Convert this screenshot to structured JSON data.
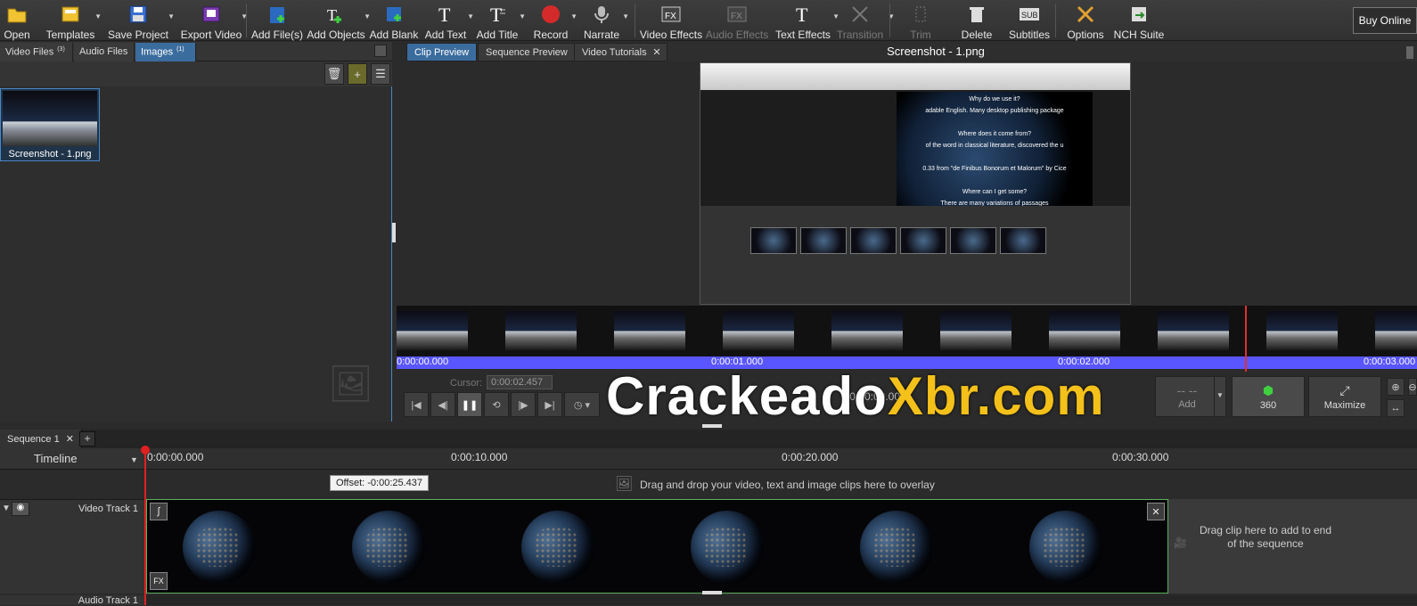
{
  "toolbar": {
    "buttons": [
      {
        "label": "Open",
        "icon": "folder-icon"
      },
      {
        "label": "Templates",
        "icon": "templates-icon"
      },
      {
        "label": "Save Project",
        "icon": "save-icon"
      },
      {
        "label": "Export Video",
        "icon": "export-icon"
      },
      {
        "label": "Add File(s)",
        "icon": "add-file-icon"
      },
      {
        "label": "Add Objects",
        "icon": "add-objects-icon"
      },
      {
        "label": "Add Blank",
        "icon": "add-blank-icon"
      },
      {
        "label": "Add Text",
        "icon": "add-text-icon"
      },
      {
        "label": "Add Title",
        "icon": "add-title-icon"
      },
      {
        "label": "Record",
        "icon": "record-icon"
      },
      {
        "label": "Narrate",
        "icon": "microphone-icon"
      },
      {
        "label": "Video Effects",
        "icon": "video-effects-icon"
      },
      {
        "label": "Audio Effects",
        "icon": "audio-effects-icon"
      },
      {
        "label": "Text Effects",
        "icon": "text-effects-icon"
      },
      {
        "label": "Transition",
        "icon": "transition-icon"
      },
      {
        "label": "Trim",
        "icon": "trim-icon"
      },
      {
        "label": "Delete",
        "icon": "trash-icon"
      },
      {
        "label": "Subtitles",
        "icon": "subtitles-icon"
      },
      {
        "label": "Options",
        "icon": "options-icon"
      },
      {
        "label": "NCH Suite",
        "icon": "nch-suite-icon"
      }
    ],
    "buy_online": "Buy Online",
    "icon_glyphs": {
      "fx": "FX",
      "sub": "SUB",
      "t": "T"
    }
  },
  "media_tabs": [
    {
      "label": "Video Files",
      "count": "(3)"
    },
    {
      "label": "Audio Files",
      "count": ""
    },
    {
      "label": "Images",
      "count": "(1)"
    }
  ],
  "media": {
    "thumb_name": "Screenshot - 1.png"
  },
  "preview_tabs": [
    "Clip Preview",
    "Sequence Preview",
    "Video Tutorials"
  ],
  "preview": {
    "title": "Screenshot - 1.png",
    "inner_text": "Why do we use it?\nadable English. Many desktop publishing package\n\nWhere does it come from?\nof the word in classical literature, discovered the u\n\n0.33 from \"de Finibus Bonorum et Malorum\" by Cice\n\nWhere can I get some?\nThere are many variations of passages",
    "ruler_labels": [
      "0:00:00.000",
      "0:00:01.000",
      "0:00:02.000",
      "0:00:03.000"
    ],
    "cursor_label": "Cursor:",
    "cursor_value": "0:00:02.457",
    "time_display": "0:00:00.000",
    "add_label": "Add",
    "btn_360_label": "360",
    "maximize_label": "Maximize"
  },
  "watermark": {
    "part1": "Crackeado",
    "part2": "Xbr.com"
  },
  "sequence": {
    "tab_label": "Sequence 1",
    "add_tab": "+",
    "timeline_label": "Timeline",
    "ruler_labels": [
      "0:00:00.000",
      "0:00:10.000",
      "0:00:20.000",
      "0:00:30.000"
    ],
    "offset_tip": "Offset: -0:00:25.437",
    "overlay_hint": "Drag and drop your video, text and image clips here to overlay",
    "video_track": "Video Track 1",
    "drop_hint": "Drag clip here to add to end of the sequence",
    "audio_track": "Audio Track 1"
  }
}
